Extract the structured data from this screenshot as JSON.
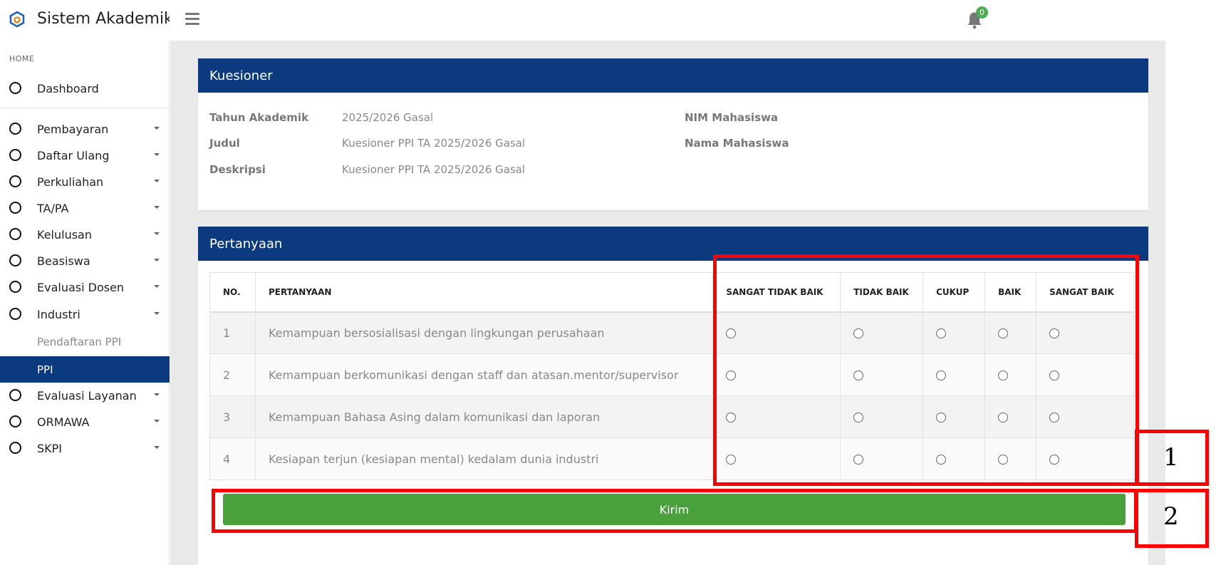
{
  "header": {
    "app_title": "Sistem Akademik",
    "notification_count": "0"
  },
  "sidebar": {
    "section": "HOME",
    "dashboard": "Dashboard",
    "items": [
      {
        "label": "Pembayaran"
      },
      {
        "label": "Daftar Ulang"
      },
      {
        "label": "Perkuliahan"
      },
      {
        "label": "TA/PA"
      },
      {
        "label": "Kelulusan"
      },
      {
        "label": "Beasiswa"
      },
      {
        "label": "Evaluasi Dosen"
      },
      {
        "label": "Industri"
      }
    ],
    "sub_items": [
      {
        "label": "Pendaftaran PPI"
      },
      {
        "label": "PPI"
      }
    ],
    "items_after": [
      {
        "label": "Evaluasi Layanan"
      },
      {
        "label": "ORMAWA"
      },
      {
        "label": "SKPI"
      }
    ]
  },
  "kuesioner": {
    "title": "Kuesioner",
    "tahun_label": "Tahun Akademik",
    "tahun_value": "2025/2026 Gasal",
    "judul_label": "Judul",
    "judul_value": "Kuesioner PPI TA 2025/2026 Gasal",
    "deskripsi_label": "Deskripsi",
    "deskripsi_value": "Kuesioner PPI TA 2025/2026 Gasal",
    "nim_label": "NIM Mahasiswa",
    "nama_label": "Nama Mahasiswa"
  },
  "pertanyaan": {
    "title": "Pertanyaan",
    "columns": [
      "NO.",
      "PERTANYAAN",
      "SANGAT TIDAK BAIK",
      "TIDAK BAIK",
      "CUKUP",
      "BAIK",
      "SANGAT BAIK"
    ],
    "rows": [
      {
        "no": "1",
        "text": "Kemampuan bersosialisasi dengan lingkungan perusahaan"
      },
      {
        "no": "2",
        "text": "Kemampuan berkomunikasi dengan staff dan atasan.mentor/supervisor"
      },
      {
        "no": "3",
        "text": "Kemampuan Bahasa Asing dalam komunikasi dan laporan"
      },
      {
        "no": "4",
        "text": "Kesiapan terjun (kesiapan mental) kedalam dunia industri"
      }
    ],
    "submit_label": "Kirim"
  },
  "annotations": {
    "label_1": "1",
    "label_2": "2",
    "color": "#ff0000"
  }
}
